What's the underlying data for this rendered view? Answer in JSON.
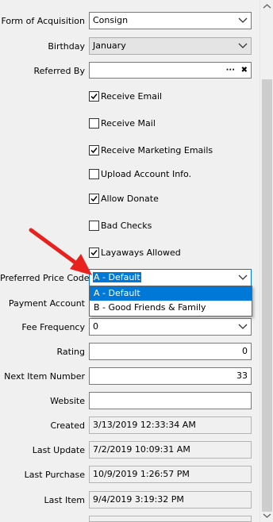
{
  "form": {
    "acquisition": {
      "label": "Form of Acquisition",
      "value": "Consign"
    },
    "birthday": {
      "label": "Birthday",
      "value": "January"
    },
    "referred_by": {
      "label": "Referred By",
      "value": ""
    },
    "preferred_price_code": {
      "label": "Preferred Price Code",
      "value": "A - Default"
    },
    "payment_account": {
      "label": "Payment Account"
    },
    "fee_frequency": {
      "label": "Fee Frequency",
      "value": "0"
    },
    "rating": {
      "label": "Rating",
      "value": "0"
    },
    "next_item_number": {
      "label": "Next Item Number",
      "value": "33"
    },
    "website": {
      "label": "Website",
      "value": ""
    },
    "created": {
      "label": "Created",
      "value": "3/13/2019 12:33:34 AM"
    },
    "last_update": {
      "label": "Last Update",
      "value": "7/2/2019 10:09:31 AM"
    },
    "last_purchase": {
      "label": "Last Purchase",
      "value": "10/9/2019 1:26:57 PM"
    },
    "last_item": {
      "label": "Last Item",
      "value": "9/4/2019 3:19:32 PM"
    }
  },
  "checkboxes": [
    {
      "label": "Receive Email",
      "checked": true
    },
    {
      "label": "Receive Mail",
      "checked": false
    },
    {
      "label": "Receive Marketing Emails",
      "checked": true
    },
    {
      "label": "Upload Account Info.",
      "checked": false
    },
    {
      "label": "Allow Donate",
      "checked": true
    },
    {
      "label": "Bad Checks",
      "checked": false
    },
    {
      "label": "Layaways Allowed",
      "checked": true
    }
  ],
  "referred_by_buttons": {
    "browse": "···",
    "clear": "✖"
  },
  "price_code_options": [
    "A - Default",
    "B - Good Friends & Family"
  ],
  "colors": {
    "accent": "#0078d7",
    "annotation_arrow": "#e8211f"
  },
  "icons": [
    "chevron-down-icon",
    "checkmark-icon",
    "ellipsis-icon",
    "clear-x-icon",
    "red-arrow-annotation"
  ]
}
